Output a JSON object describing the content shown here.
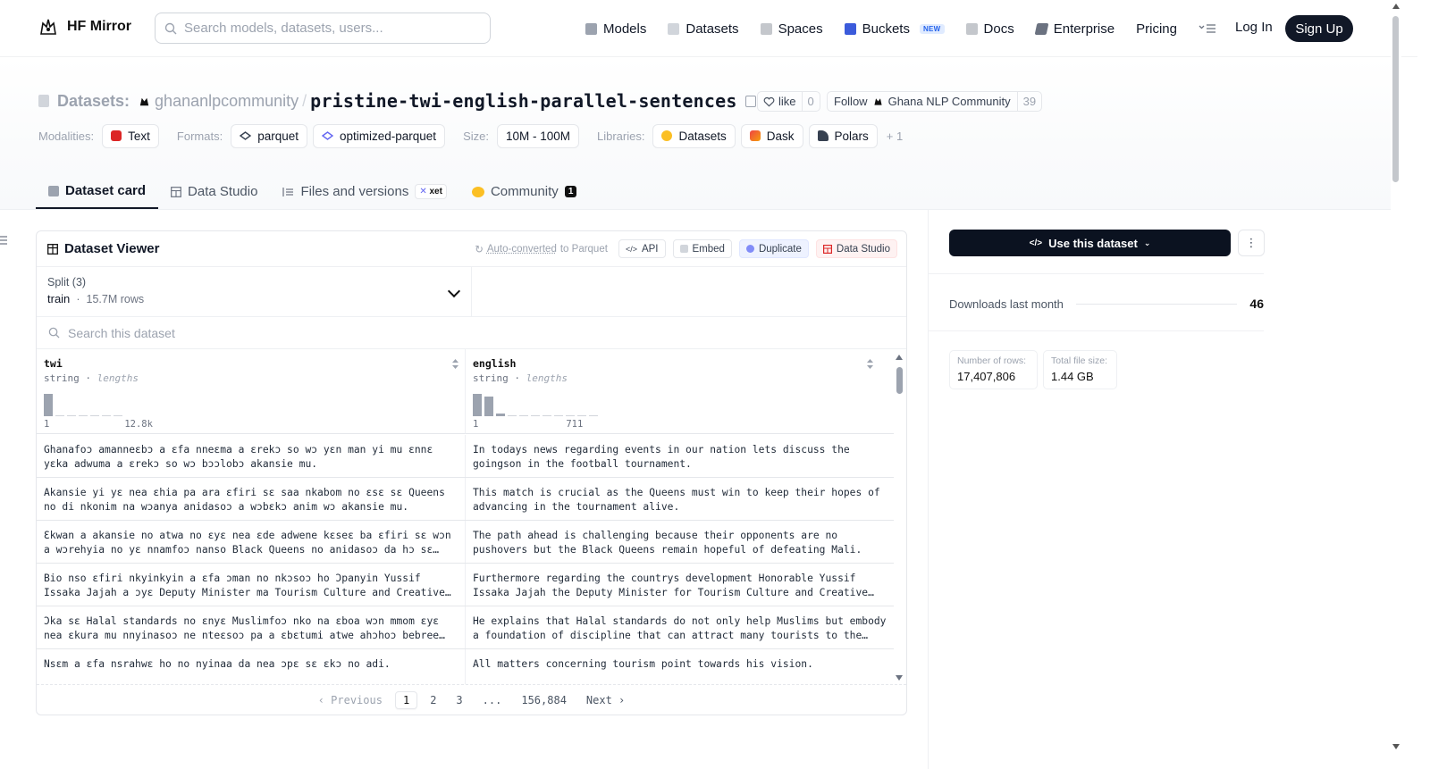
{
  "nav": {
    "brand": "HF Mirror",
    "search_placeholder": "Search models, datasets, users...",
    "links": [
      {
        "label": "Models",
        "icon": "models-icon"
      },
      {
        "label": "Datasets",
        "icon": "datasets-icon"
      },
      {
        "label": "Spaces",
        "icon": "spaces-icon"
      },
      {
        "label": "Buckets",
        "icon": "buckets-icon",
        "badge": "NEW"
      },
      {
        "label": "Docs",
        "icon": "docs-icon"
      },
      {
        "label": "Enterprise",
        "icon": "enterprise-icon"
      },
      {
        "label": "Pricing"
      }
    ],
    "login": "Log In",
    "signup": "Sign Up"
  },
  "dataset": {
    "label": "Datasets:",
    "org": "ghananlpcommunity",
    "name": "pristine-twi-english-parallel-sentences",
    "like_label": "like",
    "like_count": "0",
    "follow_label": "Follow",
    "follow_org": "Ghana NLP Community",
    "follow_count": "39"
  },
  "meta": {
    "modalities_key": "Modalities:",
    "modalities": [
      "Text"
    ],
    "formats_key": "Formats:",
    "formats": [
      "parquet",
      "optimized-parquet"
    ],
    "size_key": "Size:",
    "size": "10M - 100M",
    "libraries_key": "Libraries:",
    "libraries": [
      "Datasets",
      "Dask",
      "Polars"
    ],
    "libraries_more": "+ 1"
  },
  "tabs": [
    {
      "label": "Dataset card",
      "active": true
    },
    {
      "label": "Data Studio"
    },
    {
      "label": "Files and versions",
      "badge": "xet"
    },
    {
      "label": "Community",
      "count": "1"
    }
  ],
  "viewer": {
    "title": "Dataset Viewer",
    "auto_converted": "Auto-converted",
    "to_parquet": "to Parquet",
    "api": "API",
    "embed": "Embed",
    "duplicate": "Duplicate",
    "data_studio": "Data Studio",
    "split_label": "Split (3)",
    "split_value": "train",
    "split_rows": "15.7M rows",
    "search_placeholder": "Search this dataset",
    "columns": [
      {
        "name": "twi",
        "type": "string",
        "stat": "lengths",
        "min": "1",
        "max": "12.8k",
        "hist": [
          0.95,
          0.02,
          0.02,
          0.02,
          0.05,
          0.02,
          0.05
        ]
      },
      {
        "name": "english",
        "type": "string",
        "stat": "lengths",
        "min": "1",
        "max": "711",
        "hist": [
          0.95,
          0.85,
          0.12,
          0.05,
          0.05,
          0.05,
          0.05,
          0.05,
          0.05,
          0.05,
          0.05
        ]
      }
    ],
    "rows": [
      {
        "twi": "Ghanafoɔ amanneɛbɔ a ɛfa nneɛma a ɛrekɔ so wɔ yɛn man yi mu ɛnnɛ yɛka adwuma a ɛrekɔ so wɔ bɔɔlobɔ akansie mu.",
        "english": "In todays news regarding events in our nation lets discuss the goingson in the football tournament."
      },
      {
        "twi": "Akansie yi yɛ nea ɛhia pa ara ɛfiri sɛ saa nkabom no ɛsɛ sɛ Queens no di nkonim na wɔanya anidasoɔ a wɔbɛkɔ anim wɔ akansie mu.",
        "english": "This match is crucial as the Queens must win to keep their hopes of advancing in the tournament alive."
      },
      {
        "twi": "Ɛkwan a akansie no atwa no ɛyɛ nea ɛde adwene kɛseɛ ba ɛfiri sɛ wɔn a wɔrehyia no yɛ nnamfoɔ nanso Black Queens no anidasoɔ da hɔ sɛ wɔbɛdi Mali so.",
        "english": "The path ahead is challenging because their opponents are no pushovers but the Black Queens remain hopeful of defeating Mali."
      },
      {
        "twi": "Bio nso ɛfiri nkyinkyin a ɛfa ɔman no nkɔsoɔ ho Ɔpanyin Yussif Issaka Jajah a ɔyɛ Deputy Minister ma Tourism Culture and Creative Arts no",
        "english": "Furthermore regarding the countrys development Honorable Yussif Issaka Jajah the Deputy Minister for Tourism Culture and Creative Arts"
      },
      {
        "twi": "Ɔka sɛ Halal standards no ɛnyɛ Muslimfoɔ nko na ɛboa wɔn mmom ɛyɛ nea ɛkura mu nnyinasoɔ ne nteɛsoɔ pa a ɛbɛtumi atwe ahɔhoɔ bebree aba",
        "english": "He explains that Halal standards do not only help Muslims but embody a foundation of discipline that can attract many tourists to the country."
      },
      {
        "twi": "Nsɛm a ɛfa nsrahwɛ ho no nyinaa da nea ɔpɛ sɛ ɛkɔ no adi.",
        "english": "All matters concerning tourism point towards his vision."
      }
    ],
    "pager": {
      "previous": "Previous",
      "pages": [
        "1",
        "2",
        "3",
        "...",
        "156,884"
      ],
      "current": "1",
      "next": "Next"
    }
  },
  "sidebar": {
    "use_button": "Use this dataset",
    "downloads_label": "Downloads last month",
    "downloads_value": "46",
    "rows_label": "Number of rows:",
    "rows_value": "17,407,806",
    "size_label": "Total file size:",
    "size_value": "1.44 GB"
  }
}
